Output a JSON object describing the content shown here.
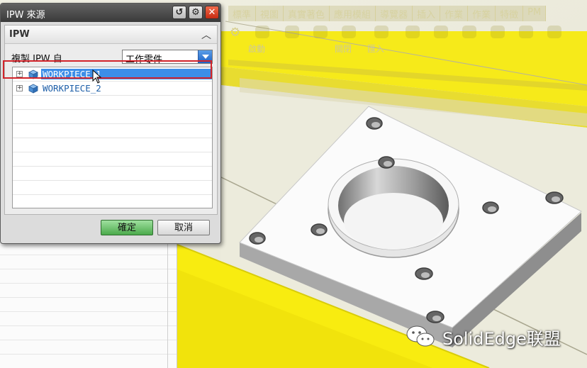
{
  "dialog": {
    "title": "IPW 來源",
    "panel_title": "IPW",
    "copy_label": "複製 IPW 自",
    "source_value": "工作零件",
    "tree_items": [
      {
        "label": "WORKPIECE_1",
        "selected": true
      },
      {
        "label": "WORKPIECE_2",
        "selected": false
      }
    ],
    "ok_label": "確定",
    "cancel_label": "取消",
    "icons": [
      "help-icon",
      "settings-icon",
      "close-icon",
      "collapse-chevron-up-icon",
      "dropdown-arrow-icon",
      "tree-expander-icon",
      "part-icon"
    ]
  },
  "ribbon": {
    "tabs": [
      "標準",
      "視圖",
      "真實著色",
      "應用模組",
      "導覽器",
      "插入",
      "作業",
      "作業",
      "特徵",
      "PM"
    ],
    "buttons": [
      "啟動",
      "關閉",
      "匯入"
    ]
  },
  "watermark": {
    "text": "SolidEdge联盟",
    "icon": "wechat-icon"
  },
  "colors": {
    "selection": "#3d8ee8",
    "highlight_box": "#d2232a",
    "ok_button": "#4caa4c",
    "viewport_yellow": "#f8ec10",
    "viewport_bg": "#eaeada"
  }
}
